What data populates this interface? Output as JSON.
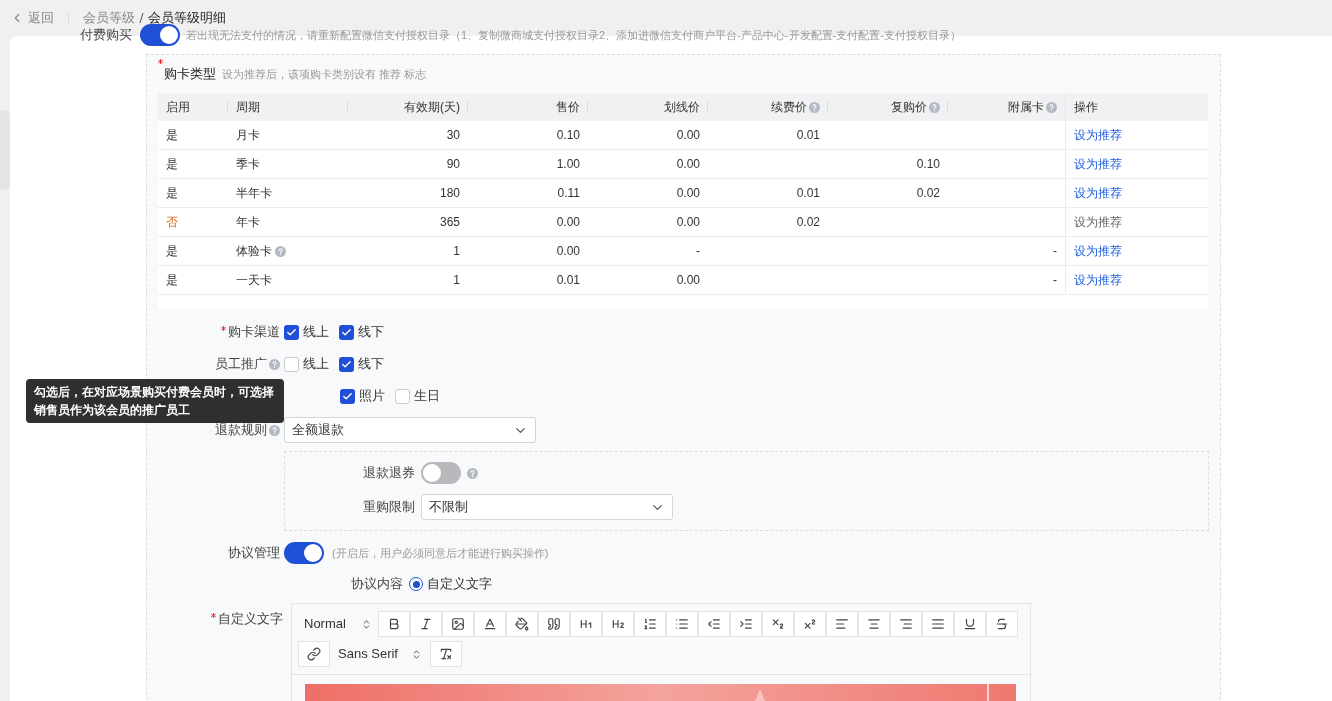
{
  "topbar": {
    "back": "返回",
    "breadcrumbs": [
      "会员等级",
      "会员等级明细"
    ]
  },
  "paid_purchase": {
    "label": "付费购买",
    "on": true,
    "hint": "若出现无法支付的情况，请重新配置微信支付授权目录（1、复制微商城支付授权目录2、添加进微信支付商户平台-产品中心-开发配置-支付配置-支付授权目录）"
  },
  "card_types": {
    "title": "购卡类型",
    "required": true,
    "hint": "设为推荐后，该项购卡类别设有 推荐 标志",
    "columns": [
      {
        "label": "启用"
      },
      {
        "label": "周期"
      },
      {
        "label": "有效期(天)"
      },
      {
        "label": "售价"
      },
      {
        "label": "划线价"
      },
      {
        "label": "续费价",
        "help": true
      },
      {
        "label": "复购价",
        "help": true
      },
      {
        "label": "附属卡",
        "help": true
      },
      {
        "label": "操作"
      }
    ],
    "rows": [
      {
        "enabled": true,
        "enabled_text": "是",
        "period": "月卡",
        "days": "30",
        "price": "0.10",
        "list_price": "0.00",
        "renew_price": "0.01",
        "rebuy_price": "",
        "sub_card": "",
        "action": "设为推荐"
      },
      {
        "enabled": true,
        "enabled_text": "是",
        "period": "季卡",
        "days": "90",
        "price": "1.00",
        "list_price": "0.00",
        "renew_price": "",
        "rebuy_price": "0.10",
        "sub_card": "",
        "action": "设为推荐"
      },
      {
        "enabled": true,
        "enabled_text": "是",
        "period": "半年卡",
        "days": "180",
        "price": "0.11",
        "list_price": "0.00",
        "renew_price": "0.01",
        "rebuy_price": "0.02",
        "sub_card": "",
        "action": "设为推荐"
      },
      {
        "enabled": false,
        "enabled_text": "否",
        "period": "年卡",
        "days": "365",
        "price": "0.00",
        "list_price": "0.00",
        "renew_price": "0.02",
        "rebuy_price": "",
        "sub_card": "",
        "action": "设为推荐"
      },
      {
        "enabled": true,
        "enabled_text": "是",
        "period": "体验卡",
        "period_help": true,
        "days": "1",
        "price": "0.00",
        "list_price": "-",
        "renew_price": "",
        "rebuy_price": "",
        "sub_card": "-",
        "action": "设为推荐"
      },
      {
        "enabled": true,
        "enabled_text": "是",
        "period": "一天卡",
        "days": "1",
        "price": "0.01",
        "list_price": "0.00",
        "renew_price": "",
        "rebuy_price": "",
        "sub_card": "-",
        "action": "设为推荐"
      }
    ]
  },
  "channels": {
    "label": "购卡渠道",
    "required": true,
    "options": [
      {
        "label": "线上",
        "checked": true
      },
      {
        "label": "线下",
        "checked": true
      }
    ]
  },
  "staff_promo": {
    "label": "员工推广",
    "help": true,
    "options": [
      {
        "label": "线上",
        "checked": false
      },
      {
        "label": "线下",
        "checked": true
      }
    ]
  },
  "info_fields": {
    "options": [
      {
        "label": "照片",
        "checked": true
      },
      {
        "label": "生日",
        "checked": false
      }
    ]
  },
  "refund_rule": {
    "label": "退款规则",
    "help": true,
    "value": "全额退款"
  },
  "refund_coupon": {
    "label": "退款退券",
    "on": false
  },
  "rebuy_limit": {
    "label": "重购限制",
    "value": "不限制"
  },
  "agreement": {
    "label": "协议管理",
    "on": true,
    "hint": "(开启后，用户必须同意后才能进行购买操作)"
  },
  "agreement_content": {
    "label": "协议内容",
    "options": [
      {
        "label": "自定义文字",
        "selected": true
      }
    ]
  },
  "custom_text": {
    "label": "自定义文字",
    "required": true,
    "format": "Normal",
    "font": "Sans Serif"
  },
  "tooltip": "勾选后，在对应场景购买付费会员时，可选择销售员作为该会员的推广员工"
}
